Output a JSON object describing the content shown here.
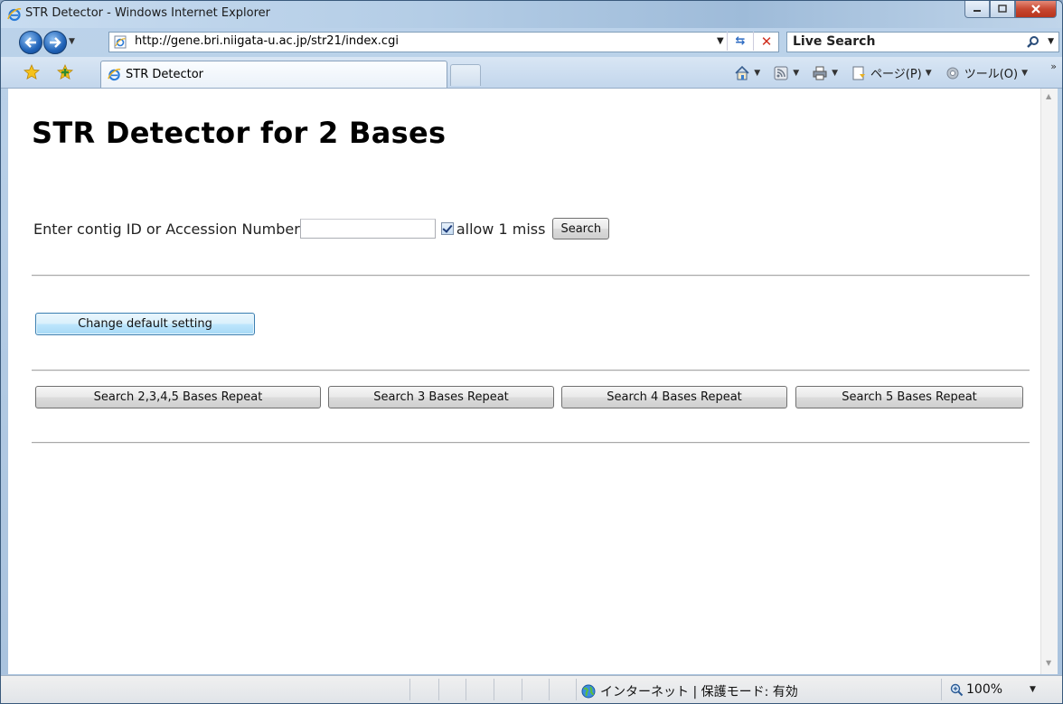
{
  "window": {
    "title": "STR Detector - Windows Internet Explorer"
  },
  "address_bar": {
    "url": "http://gene.bri.niigata-u.ac.jp/str21/index.cgi",
    "search_placeholder": "Live Search"
  },
  "tabs": [
    {
      "label": "STR Detector",
      "active": true
    }
  ],
  "command_bar": {
    "page_menu": "ページ(P)",
    "tools_menu": "ツール(O)"
  },
  "page": {
    "title": "STR Detector for 2 Bases",
    "search_label": "Enter contig ID or Accession Number",
    "contig_input_value": "",
    "allow_miss_label": "allow 1 miss",
    "allow_miss_checked": true,
    "search_button": "Search",
    "change_default_button": "Change default setting",
    "repeat_buttons": [
      "Search 2,3,4,5 Bases Repeat",
      "Search 3 Bases Repeat",
      "Search 4 Bases Repeat",
      "Search 5 Bases Repeat"
    ]
  },
  "status_bar": {
    "zone": "インターネット | 保護モード: 有効",
    "zoom": "100%"
  },
  "icons": {
    "ie_logo": "ie-icon",
    "back": "back-arrow-icon",
    "forward": "forward-arrow-icon",
    "refresh": "refresh-icon",
    "stop": "stop-icon",
    "search": "search-icon",
    "favorites": "favorites-star-icon",
    "add_favorites": "add-favorites-icon",
    "home": "home-icon",
    "feeds": "rss-feed-icon",
    "print": "print-icon",
    "page": "page-icon",
    "tools": "gear-icon",
    "globe": "globe-icon",
    "zoom": "magnifier-icon"
  }
}
